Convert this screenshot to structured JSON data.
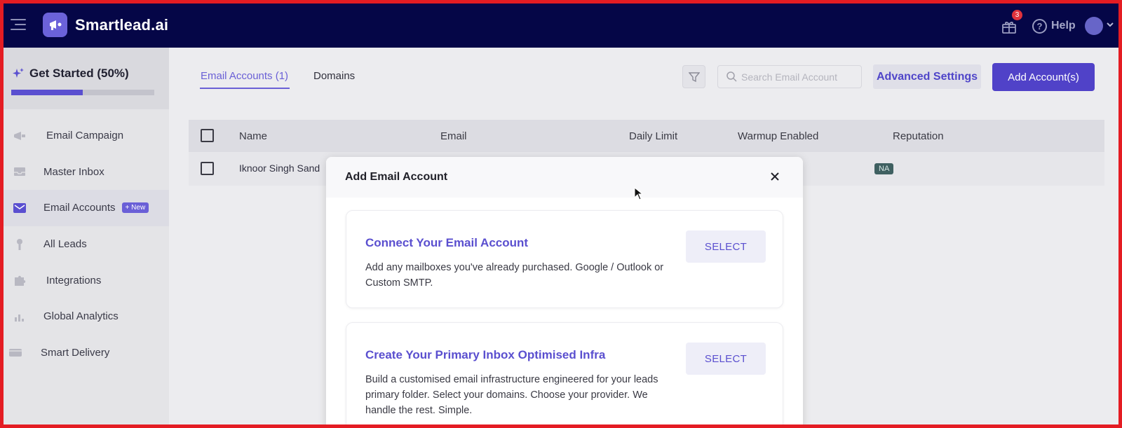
{
  "app": {
    "name": "Smartlead.ai",
    "gift_badge_count": "3",
    "help_label": "Help"
  },
  "onboarding": {
    "title": "Get Started (50%)",
    "progress_fraction": 0.5
  },
  "sidebar": {
    "items": [
      {
        "label": "Email Campaign",
        "icon": "megaphone-icon"
      },
      {
        "label": "Master Inbox",
        "icon": "inbox-icon"
      },
      {
        "label": "Email Accounts",
        "icon": "mail-icon",
        "badge": "+ New",
        "active": true
      },
      {
        "label": "All Leads",
        "icon": "leads-icon"
      },
      {
        "label": "Integrations",
        "icon": "puzzle-icon"
      },
      {
        "label": "Global Analytics",
        "icon": "bar-chart-icon"
      },
      {
        "label": "Smart Delivery",
        "icon": "delivery-icon"
      }
    ]
  },
  "main": {
    "tabs": [
      {
        "label": "Email Accounts (1)",
        "active": true
      },
      {
        "label": "Domains",
        "active": false
      }
    ],
    "search_placeholder": "Search Email Account",
    "advanced_settings_label": "Advanced Settings",
    "add_account_label": "Add Account(s)",
    "table": {
      "columns": [
        "Name",
        "Email",
        "Daily Limit",
        "Warmup Enabled",
        "Reputation"
      ],
      "rows": [
        {
          "name": "Iknoor Singh Sand",
          "reputation": "NA"
        }
      ]
    }
  },
  "modal": {
    "title": "Add Email Account",
    "options": [
      {
        "title": "Connect Your Email Account",
        "description": "Add any mailboxes you've already purchased. Google / Outlook or Custom SMTP.",
        "button": "SELECT"
      },
      {
        "title": "Create Your Primary Inbox Optimised Infra",
        "description": "Build a customised email infrastructure engineered for your leads primary folder. Select your domains. Choose your provider. We handle the rest. Simple.",
        "button": "SELECT"
      }
    ]
  },
  "colors": {
    "topbar": "#050647",
    "accent": "#5042c8",
    "frame": "#e41c23"
  }
}
